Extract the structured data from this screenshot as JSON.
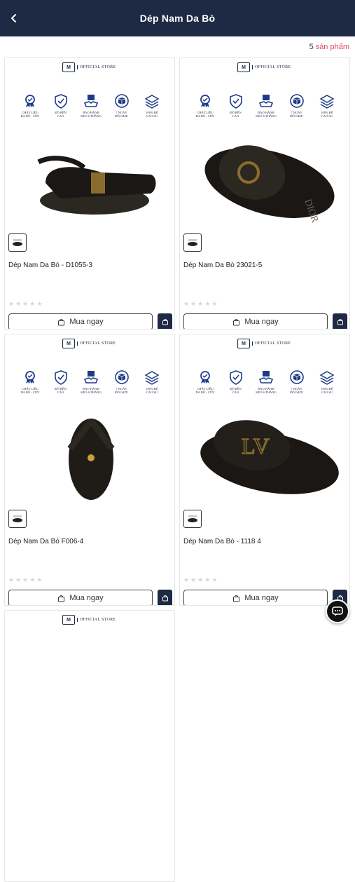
{
  "header": {
    "title": "Dép Nam Da Bò"
  },
  "count": {
    "number": "5",
    "label": "sản phẩm"
  },
  "store": {
    "logo_text": "M",
    "name": "OFFICIAL STORE"
  },
  "badges": [
    {
      "icon": "medal-icon",
      "label": "CHẤT LIỆU\nDA BÒ - CỪU"
    },
    {
      "icon": "shield-icon",
      "label": "ĐỘ BỀN\nCAO"
    },
    {
      "icon": "handshake-icon",
      "label": "BẢO HÀNH\nKEO 6 THÁNG"
    },
    {
      "icon": "box-icon",
      "label": "7 NGÀY\nĐỔI SIZE"
    },
    {
      "icon": "layers-icon",
      "label": "100% ĐẾ\nCAO SU"
    }
  ],
  "products": [
    {
      "name": "Dép Nam Da Bò - D1055-3",
      "rating": 0,
      "buy_label": "Mua ngay"
    },
    {
      "name": "Dép Nam Da Bò 23021-5",
      "rating": 0,
      "buy_label": "Mua ngay"
    },
    {
      "name": "Dép Nam Da Bò F006-4",
      "rating": 0,
      "buy_label": "Mua ngay"
    },
    {
      "name": "Dép Nam Da Bò - 1118 4",
      "rating": 0,
      "buy_label": "Mua ngay"
    },
    {
      "name": "",
      "rating": 0,
      "buy_label": ""
    }
  ],
  "colors": {
    "header_bg": "#1e2a44",
    "accent": "#e04a6a"
  }
}
